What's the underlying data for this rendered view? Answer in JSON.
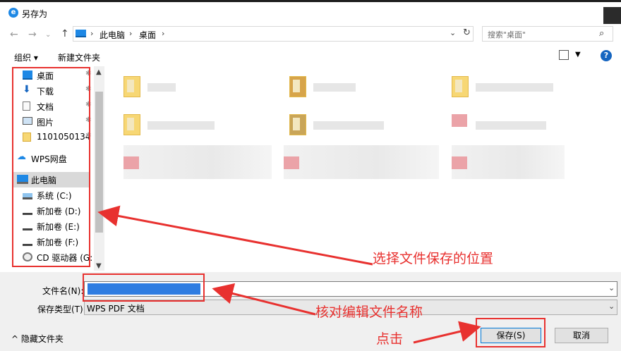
{
  "window": {
    "title": "另存为"
  },
  "address": {
    "segments": [
      "此电脑",
      "桌面"
    ],
    "search_placeholder": "搜索\"桌面\""
  },
  "toolbar": {
    "organize_label": "组织 ▾",
    "new_folder_label": "新建文件夹"
  },
  "nav": {
    "items": [
      {
        "label": "桌面",
        "icon": "desktop-icon",
        "pinned": true
      },
      {
        "label": "下载",
        "icon": "download-icon",
        "pinned": true
      },
      {
        "label": "文档",
        "icon": "document-icon",
        "pinned": true
      },
      {
        "label": "图片",
        "icon": "picture-icon",
        "pinned": true
      },
      {
        "label": "1101050134",
        "icon": "folder-icon",
        "pinned": true
      },
      {
        "label": "WPS网盘",
        "icon": "cloud-icon",
        "pinned": false
      },
      {
        "label": "此电脑",
        "icon": "computer-icon",
        "pinned": false,
        "selected": true
      },
      {
        "label": "系统 (C:)",
        "icon": "drive-icon",
        "pinned": false
      },
      {
        "label": "新加卷 (D:)",
        "icon": "drive-icon",
        "pinned": false
      },
      {
        "label": "新加卷 (E:)",
        "icon": "drive-icon",
        "pinned": false
      },
      {
        "label": "新加卷 (F:)",
        "icon": "drive-icon",
        "pinned": false
      },
      {
        "label": "CD 驱动器 (G:",
        "icon": "cd-drive-icon",
        "pinned": false
      }
    ]
  },
  "bottom": {
    "filename_label": "文件名(N):",
    "filename_value": "",
    "filetype_label": "保存类型(T):",
    "filetype_value": "WPS PDF 文档",
    "hide_folders_label": "^ 隐藏文件夹",
    "save_label": "保存(S)",
    "cancel_label": "取消"
  },
  "annotations": {
    "location_note": "选择文件保存的位置",
    "filename_note": "核对编辑文件名称",
    "click_note": "点击"
  },
  "colors": {
    "annotation_red": "#e8312f",
    "selection_blue": "#2f7de1",
    "accent": "#0078d7"
  }
}
